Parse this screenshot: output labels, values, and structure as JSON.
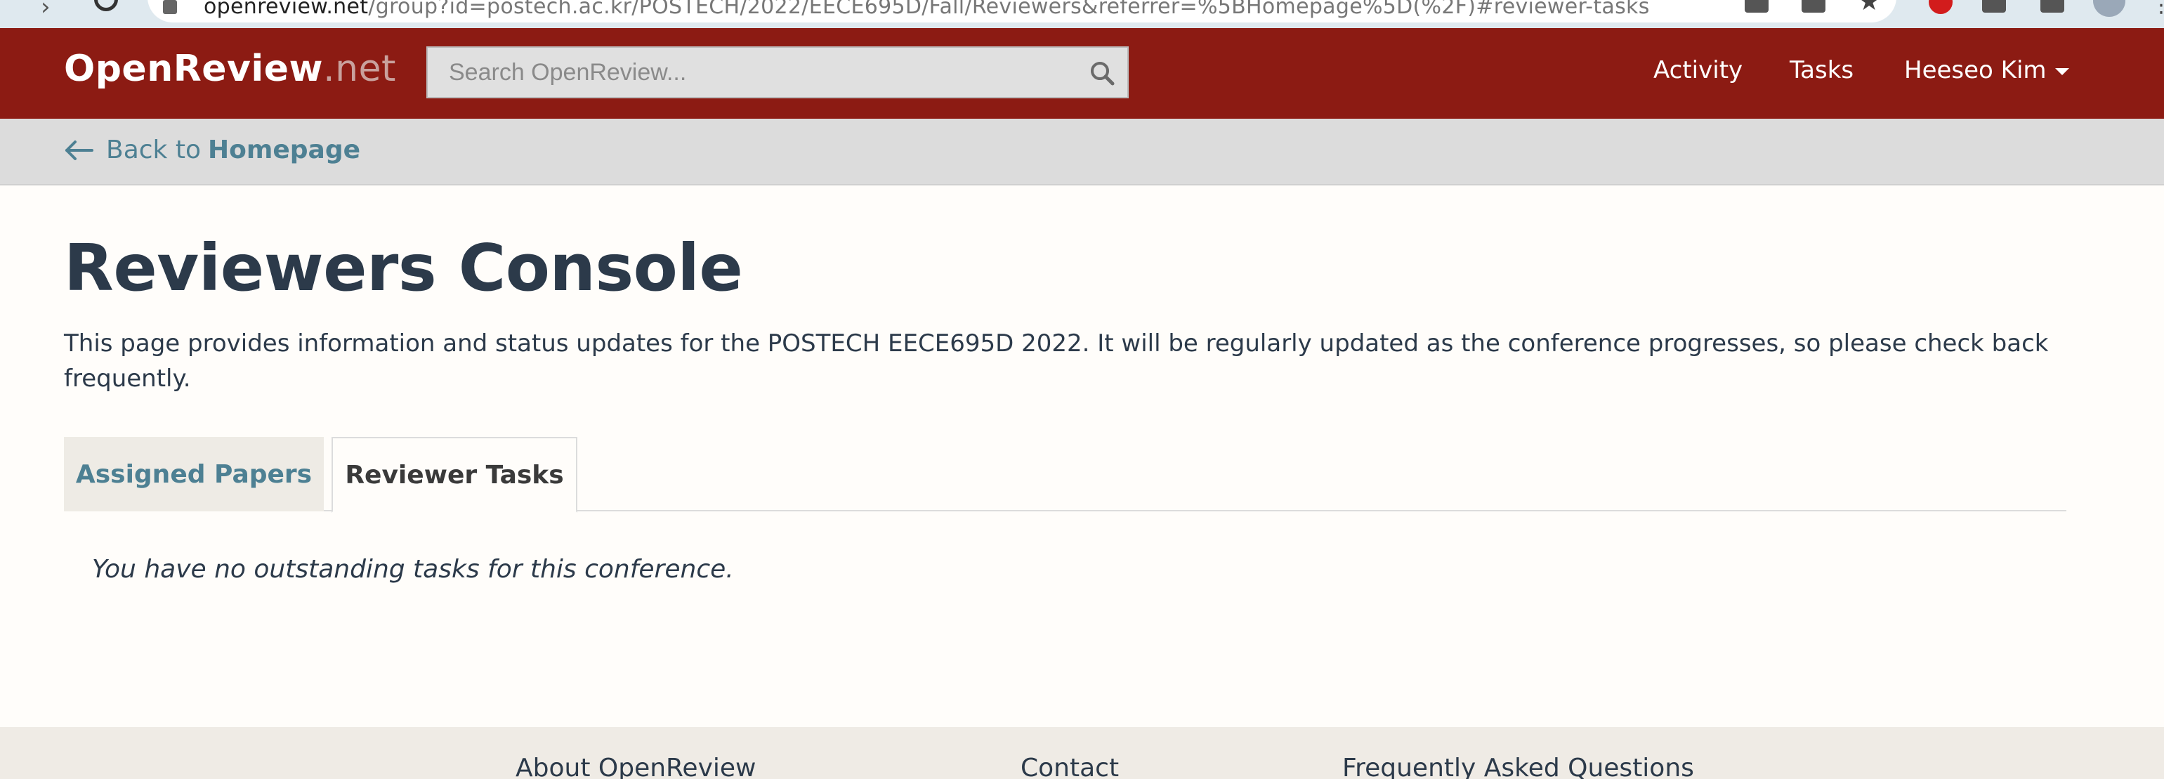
{
  "browser": {
    "url_host": "openreview.net",
    "url_path": "/group?id=postech.ac.kr/POSTECH/2022/EECE695D/Fall/Reviewers&referrer=%5BHomepage%5D(%2F)#reviewer-tasks"
  },
  "navbar": {
    "brand_main": "OpenReview",
    "brand_tld": ".net",
    "search_placeholder": "Search OpenReview...",
    "links": {
      "activity": "Activity",
      "tasks": "Tasks",
      "user": "Heeseo Kim"
    },
    "accent_color": "#8c1b13"
  },
  "breadcrumb": {
    "prefix": "Back to",
    "target": "Homepage"
  },
  "main": {
    "title": "Reviewers Console",
    "description": "This page provides information and status updates for the POSTECH EECE695D 2022. It will be regularly updated as the conference progresses, so please check back frequently.",
    "tabs": [
      {
        "label": "Assigned Papers",
        "active": false
      },
      {
        "label": "Reviewer Tasks",
        "active": true
      }
    ],
    "empty_message": "You have no outstanding tasks for this conference."
  },
  "footer": {
    "links": [
      "About OpenReview",
      "Contact",
      "Frequently Asked Questions"
    ]
  }
}
